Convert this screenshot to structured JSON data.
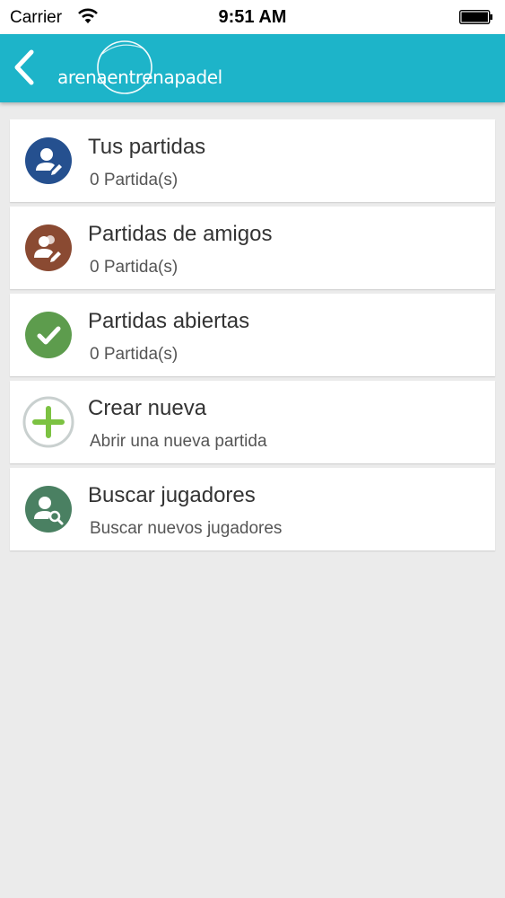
{
  "status_bar": {
    "carrier": "Carrier",
    "time": "9:51 AM"
  },
  "nav": {
    "back_icon": "chevron-left-icon",
    "logo_text": "arenaentrenapadel",
    "bar_color": "#1db4c9"
  },
  "items": [
    {
      "title": "Tus partidas",
      "subtitle": "0 Partida(s)",
      "icon": "user-edit-icon",
      "color": "#25508f"
    },
    {
      "title": "Partidas de amigos",
      "subtitle": "0 Partida(s)",
      "icon": "friends-edit-icon",
      "color": "#8a4a32"
    },
    {
      "title": "Partidas abiertas",
      "subtitle": "0 Partida(s)",
      "icon": "checkmark-icon",
      "color": "#5d9c4d"
    },
    {
      "title": "Crear nueva",
      "subtitle": "Abrir una nueva partida",
      "icon": "plus-icon",
      "color": "#7cc242"
    },
    {
      "title": "Buscar jugadores",
      "subtitle": "Buscar nuevos jugadores",
      "icon": "user-search-icon",
      "color": "#4a8062"
    }
  ]
}
